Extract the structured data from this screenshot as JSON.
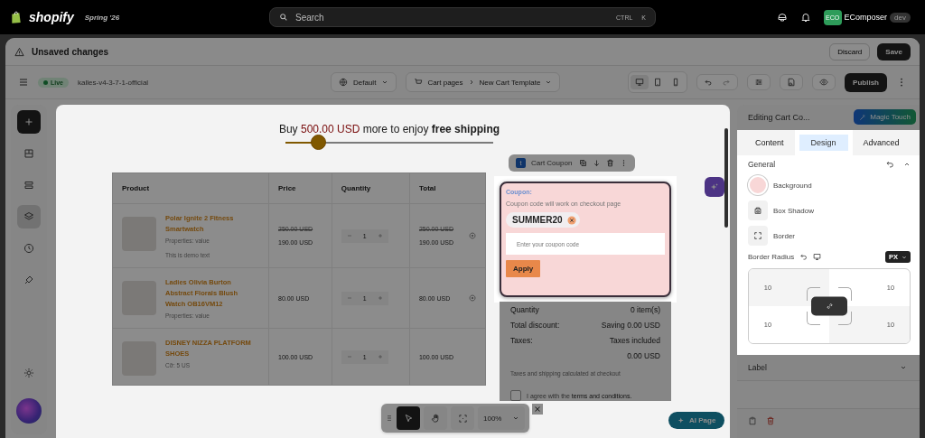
{
  "topbar": {
    "logo": "shopify",
    "edition": "Spring '26",
    "search": {
      "placeholder": "Search",
      "shortcut": [
        "CTRL",
        "K"
      ]
    },
    "store_badge": "ECO",
    "store": "EComposer",
    "env": "dev"
  },
  "notice": {
    "title": "Unsaved changes",
    "discard": "Discard",
    "save": "Save"
  },
  "toolbar": {
    "status": "Live",
    "theme": "kalles-v4-3-7-1-official",
    "language": "Default",
    "breadcrumb": [
      "Cart pages",
      "New Cart Template"
    ],
    "devices": [
      {
        "kind": "desktop",
        "selected": true
      },
      {
        "kind": "tablet",
        "selected": false
      },
      {
        "kind": "mobile",
        "selected": false
      }
    ],
    "publish": "Publish"
  },
  "sidebar": {
    "items": [
      {
        "kind": "add",
        "selected": false
      },
      {
        "kind": "sections",
        "selected": false
      },
      {
        "kind": "rows",
        "selected": false
      },
      {
        "kind": "layers",
        "selected": true
      },
      {
        "kind": "history",
        "selected": false
      },
      {
        "kind": "brush",
        "selected": false
      }
    ],
    "footer": [
      {
        "kind": "settings",
        "selected": false
      }
    ]
  },
  "shipping": {
    "lead": "Buy",
    "amount": "500.00 USD",
    "tail": "more to enjoy **free shipping**",
    "level": 0.16
  },
  "cart": {
    "columns": [
      "Product",
      "Price",
      "Quantity",
      "Total"
    ],
    "rows": [
      {
        "name": "Polar Ignite 2 Fitness Smartwatch",
        "detail": "Properties: value",
        "note": "This is demo text",
        "compare_price": "250.00 USD",
        "price": "190.00 USD",
        "quantity": "1",
        "compare_total": "250.00 USD",
        "total": "190.00 USD",
        "removable": true
      },
      {
        "name": "Ladies Olivia Burton Abstract Florals Blush Watch OB16VM12",
        "detail": "Properties: value",
        "price": "80.00 USD",
        "quantity": "1",
        "total": "80.00 USD",
        "removable": true
      },
      {
        "name": "DISNEY NIZZA PLATFORM SHOES",
        "detail": "Cỡ: 5 US",
        "price": "100.00 USD",
        "quantity": "1",
        "total": "100.00 USD",
        "removable": false
      }
    ]
  },
  "element_toolbar": {
    "badge": "t",
    "label": "Cart Coupon"
  },
  "coupon": {
    "label": "Coupon:",
    "hint": "Coupon code will work on checkout page",
    "applied": [
      "SUMMER20"
    ],
    "placeholder": "Enter your coupon code",
    "button": "Apply"
  },
  "summary": {
    "rows": [
      {
        "label": "Quantity",
        "value": "0 item(s)"
      },
      {
        "label": "Total discount:",
        "value": "Saving 0.00 USD"
      },
      {
        "label": "Taxes:",
        "value": "Taxes included"
      },
      {
        "value": "0.00 USD"
      }
    ],
    "note": "Taxes and shipping calculated at checkout",
    "agree": {
      "checked": false,
      "text": "I agree with the",
      "link": "terms and conditions."
    }
  },
  "canvas_tools": {
    "tools": [
      {
        "kind": "pointer",
        "selected": true
      },
      {
        "kind": "hand",
        "selected": false
      },
      {
        "kind": "focus",
        "selected": false
      }
    ],
    "zoom": "100%"
  },
  "ai_page": "AI Page",
  "panel": {
    "title": "Editing Cart Co...",
    "magic": "Magic Touch",
    "tabs": [
      {
        "label": "Content",
        "selected": false
      },
      {
        "label": "Design",
        "selected": true
      },
      {
        "label": "Advanced",
        "selected": false
      }
    ],
    "general": {
      "title": "General",
      "expanded": true,
      "properties": [
        {
          "kind": "color",
          "label": "Background",
          "color": "#f8d7d7"
        },
        {
          "kind": "shadow",
          "label": "Box Shadow"
        },
        {
          "kind": "border",
          "label": "Border"
        }
      ],
      "radius": {
        "label": "Border Radius",
        "unit": "PX",
        "values": [
          "10",
          "10",
          "10",
          "10"
        ],
        "linked": true
      }
    },
    "sections": [
      {
        "title": "Label",
        "expanded": false
      }
    ]
  }
}
